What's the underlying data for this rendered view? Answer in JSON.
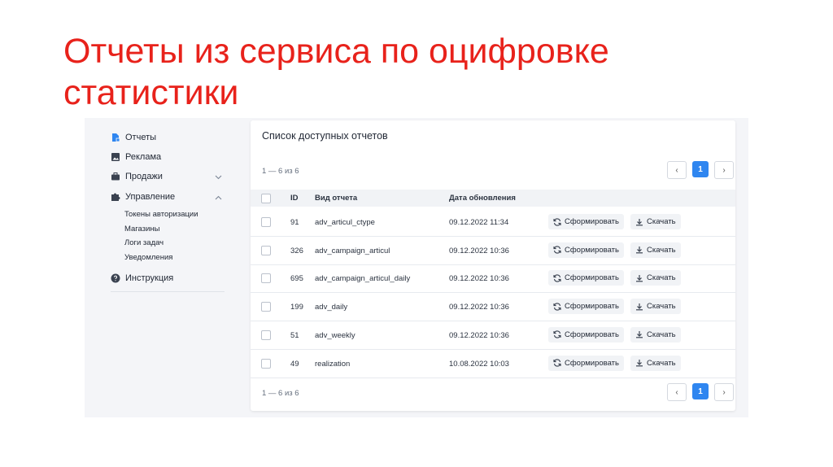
{
  "slide": {
    "title_line1": "Отчеты из сервиса по оцифровке",
    "title_line2": "статистики"
  },
  "colors": {
    "title": "#e8221b",
    "accent": "#2f86f0",
    "sidebar_bg": "#f4f5f8",
    "card_bg": "#ffffff"
  },
  "sidebar": {
    "items": [
      {
        "label": "Отчеты",
        "icon": "document-chart-icon",
        "active": true
      },
      {
        "label": "Реклама",
        "icon": "image-icon"
      },
      {
        "label": "Продажи",
        "icon": "briefcase-icon",
        "chevron": "down"
      },
      {
        "label": "Управление",
        "icon": "puzzle-icon",
        "chevron": "up"
      }
    ],
    "subitems": [
      "Токены авторизации",
      "Магазины",
      "Логи задач",
      "Уведомления"
    ],
    "help": {
      "label": "Инструкция",
      "icon": "question-circle-icon"
    }
  },
  "card": {
    "title": "Список доступных отчетов",
    "count_top": "1 — 6 из 6",
    "count_bottom": "1 — 6 из 6",
    "pager": {
      "current": "1",
      "prev_icon": "chevron-left-icon",
      "next_icon": "chevron-right-icon"
    },
    "columns": {
      "id": "ID",
      "type": "Вид отчета",
      "updated": "Дата обновления"
    },
    "generate_label": "Сформировать",
    "download_label": "Скачать",
    "rows": [
      {
        "id": "91",
        "type": "adv_articul_ctype",
        "updated": "09.12.2022 11:34"
      },
      {
        "id": "326",
        "type": "adv_campaign_articul",
        "updated": "09.12.2022 10:36"
      },
      {
        "id": "695",
        "type": "adv_campaign_articul_daily",
        "updated": "09.12.2022 10:36"
      },
      {
        "id": "199",
        "type": "adv_daily",
        "updated": "09.12.2022 10:36"
      },
      {
        "id": "51",
        "type": "adv_weekly",
        "updated": "09.12.2022 10:36"
      },
      {
        "id": "49",
        "type": "realization",
        "updated": "10.08.2022 10:03"
      }
    ]
  }
}
